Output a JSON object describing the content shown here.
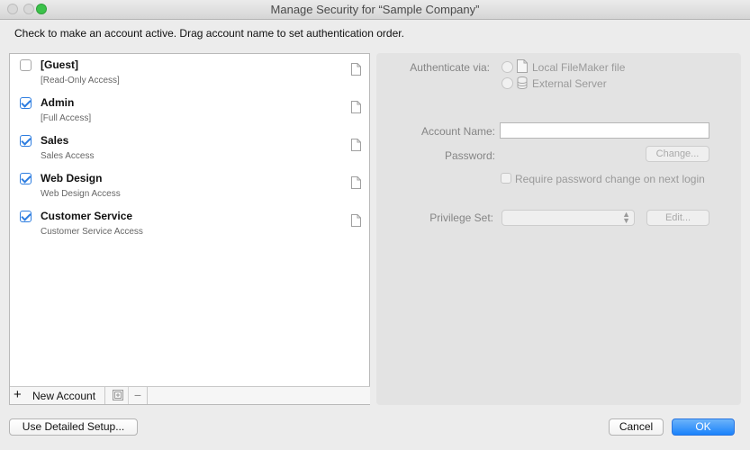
{
  "window": {
    "title": "Manage Security for “Sample Company”"
  },
  "instructions": "Check to make an account active.  Drag account name to set authentication order.",
  "accounts": [
    {
      "name": "[Guest]",
      "privilege": "[Read-Only Access]",
      "active": false
    },
    {
      "name": "Admin",
      "privilege": "[Full Access]",
      "active": true
    },
    {
      "name": "Sales",
      "privilege": "Sales Access",
      "active": true
    },
    {
      "name": "Web Design",
      "privilege": "Web Design Access",
      "active": true
    },
    {
      "name": "Customer Service",
      "privilege": "Customer Service Access",
      "active": true
    }
  ],
  "list_footer": {
    "new_account_label": "New Account",
    "add_icon": "plus-icon",
    "duplicate_icon": "duplicate-icon",
    "remove_icon": "minus-icon"
  },
  "details": {
    "authenticate_label": "Authenticate via:",
    "option_local": "Local FileMaker file",
    "option_external": "External Server",
    "account_name_label": "Account Name:",
    "account_name_value": "",
    "password_label": "Password:",
    "change_button": "Change...",
    "require_change_label": "Require password change on next login",
    "privilege_set_label": "Privilege Set:",
    "privilege_set_value": "",
    "edit_button": "Edit..."
  },
  "footer": {
    "detailed_setup_button": "Use Detailed Setup...",
    "cancel_button": "Cancel",
    "ok_button": "OK"
  },
  "colors": {
    "accent": "#1a82fb",
    "check": "#2d7de0",
    "panel": "#e3e3e3"
  }
}
